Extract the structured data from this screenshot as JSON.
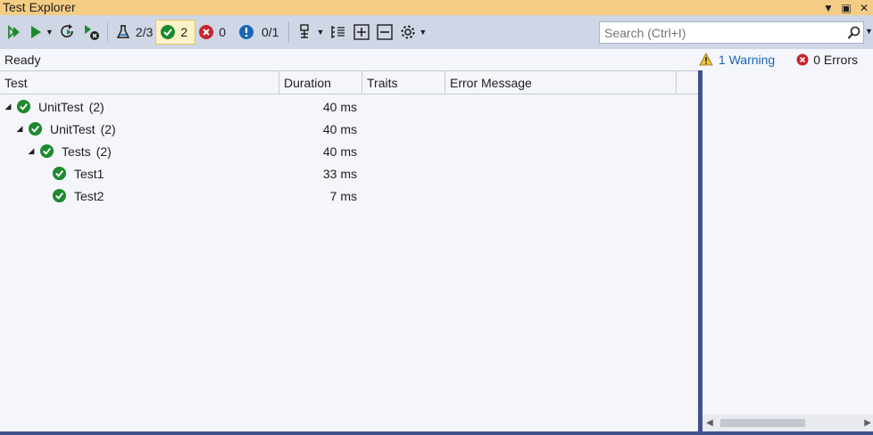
{
  "window": {
    "title": "Test Explorer",
    "pin_icon": "dropdown-arrow-icon",
    "maximize_icon": "maximize-icon",
    "close_icon": "close-icon"
  },
  "toolbar": {
    "total_tests": "2/3",
    "passed_count": "2",
    "failed_count": "0",
    "not_run_count": "0/1"
  },
  "search": {
    "placeholder": "Search (Ctrl+I)"
  },
  "status": {
    "text": "Ready",
    "warnings": "1 Warning",
    "errors": "0 Errors"
  },
  "columns": [
    "Test",
    "Duration",
    "Traits",
    "Error Message"
  ],
  "rows": [
    {
      "name": "UnitTest",
      "count": "(2)",
      "duration": "40 ms",
      "level": 0,
      "expanded": true
    },
    {
      "name": "UnitTest",
      "count": "(2)",
      "duration": "40 ms",
      "level": 1,
      "expanded": true
    },
    {
      "name": "Tests",
      "count": "(2)",
      "duration": "40 ms",
      "level": 2,
      "expanded": true
    },
    {
      "name": "Test1",
      "count": "",
      "duration": "33 ms",
      "level": 3,
      "expanded": false
    },
    {
      "name": "Test2",
      "count": "",
      "duration": "7 ms",
      "level": 3,
      "expanded": false
    }
  ],
  "colors": {
    "title_bar": "#f5cc84",
    "toolbar": "#cfd6e5",
    "pass": "#1e8a2f",
    "fail": "#c4262d",
    "info": "#1a64b4",
    "splitter": "#42528e"
  }
}
